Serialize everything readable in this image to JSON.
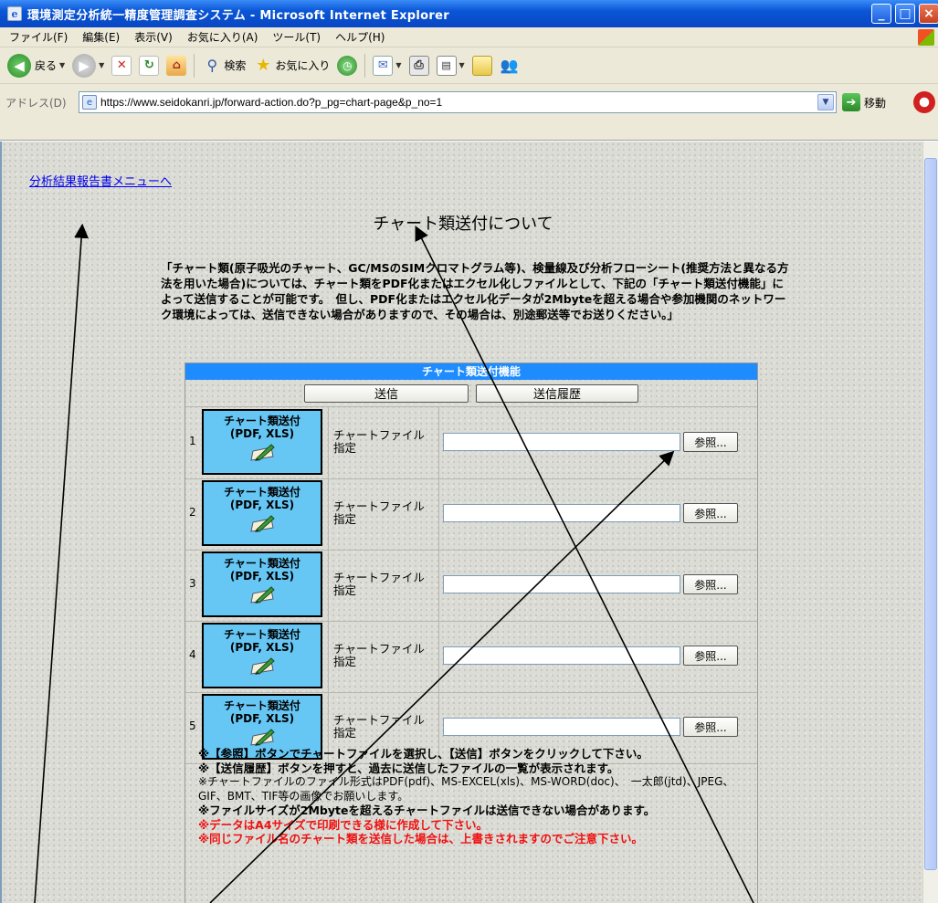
{
  "window": {
    "title": "環境測定分析統一精度管理調査システム - Microsoft Internet Explorer",
    "controls": [
      "_",
      "□",
      "×"
    ]
  },
  "menu": [
    "ファイル(F)",
    "編集(E)",
    "表示(V)",
    "お気に入り(A)",
    "ツール(T)",
    "ヘルプ(H)"
  ],
  "toolbar": {
    "back": "戻る",
    "search": "検索",
    "favorites": "お気に入り"
  },
  "address": {
    "label": "アドレス(D)",
    "url": "https://www.seidokanri.jp/forward-action.do?p_pg=chart-page&p_no=1",
    "go": "移動"
  },
  "page": {
    "menu_link": "分析結果報告書メニューへ",
    "title": "チャート類送付について",
    "intro": "「チャート類(原子吸光のチャート、GC/MSのSIMクロマトグラム等)、検量線及び分析フローシート(推奨方法と異なる方法を用いた場合)については、チャート類をPDF化またはエクセル化しファイルとして、下記の「チャート類送付機能」によって送信することが可能です。　但し、PDF化またはエクセル化データが2Mbyteを超える場合や参加機関のネットワーク環境によっては、送信できない場合がありますので、その場合は、別途郵送等でお送りください。」"
  },
  "function": {
    "header": "チャート類送付機能",
    "send_label": "送信",
    "history_label": "送信履歴",
    "rows": [
      {
        "num": "1",
        "btn_line1": "チャート類送付",
        "btn_line2": "(PDF, XLS)",
        "file_label": "チャートファイル指定",
        "browse": "参照..."
      },
      {
        "num": "2",
        "btn_line1": "チャート類送付",
        "btn_line2": "(PDF, XLS)",
        "file_label": "チャートファイル指定",
        "browse": "参照..."
      },
      {
        "num": "3",
        "btn_line1": "チャート類送付",
        "btn_line2": "(PDF, XLS)",
        "file_label": "チャートファイル指定",
        "browse": "参照..."
      },
      {
        "num": "4",
        "btn_line1": "チャート類送付",
        "btn_line2": "(PDF, XLS)",
        "file_label": "チャートファイル指定",
        "browse": "参照..."
      },
      {
        "num": "5",
        "btn_line1": "チャート類送付",
        "btn_line2": "(PDF, XLS)",
        "file_label": "チャートファイル指定",
        "browse": "参照..."
      }
    ],
    "notes": {
      "n1": "※【参照】ボタンでチャートファイルを選択し、【送信】ボタンをクリックして下さい。",
      "n2": "※【送信履歴】ボタンを押すと、過去に送信したファイルの一覧が表示されます。",
      "n3": "※チャートファイルのファイル形式はPDF(pdf)、MS-EXCEL(xls)、MS-WORD(doc)、　一太郎(jtd)、JPEG、GIF、BMT、TIF等の画像でお願いします。",
      "n4": "※ファイルサイズが2Mbyteを超えるチャートファイルは送信できない場合があります。",
      "n5": "※データはA4サイズで印刷できる様に作成して下さい。",
      "n6": "※同じファイル名のチャート類を送信した場合は、上書きされますのでご注意下さい。"
    }
  },
  "colors": {
    "header_bg": "#1e8cff",
    "chart_btn_bg": "#66c6f4",
    "link": "#0000ee",
    "warning": "#ee1111"
  }
}
